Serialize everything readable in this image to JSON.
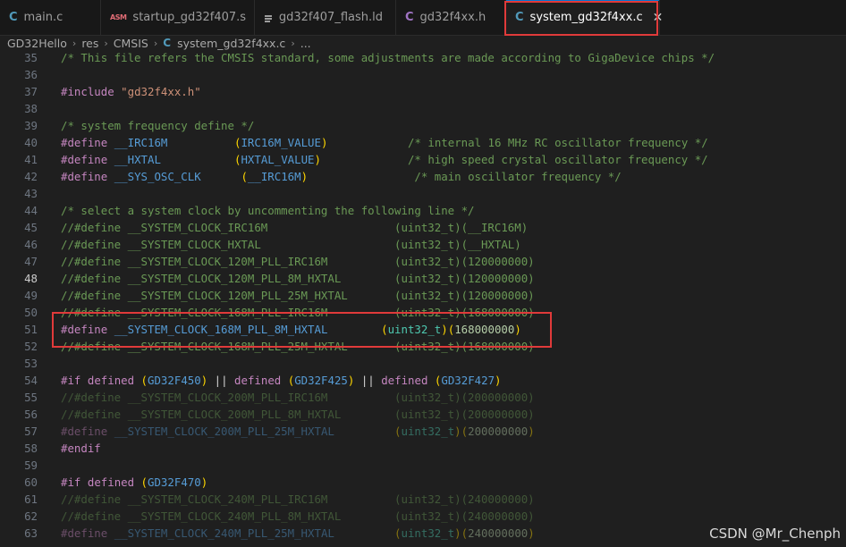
{
  "tabs": [
    {
      "icon": "c-file-icon",
      "label": "main.c"
    },
    {
      "icon": "asm-file-icon",
      "label": "startup_gd32f407.s"
    },
    {
      "icon": "linker-file-icon",
      "label": "gd32f407_flash.ld"
    },
    {
      "icon": "c-header-icon",
      "label": "gd32f4xx.h"
    },
    {
      "icon": "c-file-icon",
      "label": "system_gd32f4xx.c",
      "active": true
    }
  ],
  "tab_icons": {
    "c": "C",
    "asm": "ASM"
  },
  "close_glyph": "✕",
  "breadcrumb": [
    "GD32Hello",
    "res",
    "CMSIS",
    "system_gd32f4xx.c",
    "..."
  ],
  "breadcrumb_sep": "›",
  "current_line": 48,
  "lines": [
    {
      "n": "35",
      "code": "/* This file refers the CMSIS standard, some adjustments are made according to GigaDevice chips */"
    },
    {
      "n": "36",
      "code": ""
    },
    {
      "n": "37",
      "code": "#include \"gd32f4xx.h\""
    },
    {
      "n": "38",
      "code": ""
    },
    {
      "n": "39",
      "code": "/* system frequency define */"
    },
    {
      "n": "40",
      "code": "#define __IRC16M          (IRC16M_VALUE)            /* internal 16 MHz RC oscillator frequency */"
    },
    {
      "n": "41",
      "code": "#define __HXTAL           (HXTAL_VALUE)             /* high speed crystal oscillator frequency */"
    },
    {
      "n": "42",
      "code": "#define __SYS_OSC_CLK      (__IRC16M)                /* main oscillator frequency */"
    },
    {
      "n": "43",
      "code": ""
    },
    {
      "n": "44",
      "code": "/* select a system clock by uncommenting the following line */"
    },
    {
      "n": "45",
      "code": "//#define __SYSTEM_CLOCK_IRC16M                   (uint32_t)(__IRC16M)"
    },
    {
      "n": "46",
      "code": "//#define __SYSTEM_CLOCK_HXTAL                    (uint32_t)(__HXTAL)"
    },
    {
      "n": "47",
      "code": "//#define __SYSTEM_CLOCK_120M_PLL_IRC16M          (uint32_t)(120000000)"
    },
    {
      "n": "48",
      "code": "//#define __SYSTEM_CLOCK_120M_PLL_8M_HXTAL        (uint32_t)(120000000)"
    },
    {
      "n": "49",
      "code": "//#define __SYSTEM_CLOCK_120M_PLL_25M_HXTAL       (uint32_t)(120000000)"
    },
    {
      "n": "50",
      "code": "//#define __SYSTEM_CLOCK_168M_PLL_IRC16M          (uint32_t)(168000000)"
    },
    {
      "n": "51",
      "code": "#define __SYSTEM_CLOCK_168M_PLL_8M_HXTAL        (uint32_t)(168000000)"
    },
    {
      "n": "52",
      "code": "//#define __SYSTEM_CLOCK_168M_PLL_25M_HXTAL       (uint32_t)(168000000)"
    },
    {
      "n": "53",
      "code": ""
    },
    {
      "n": "54",
      "code": "#if defined (GD32F450) || defined (GD32F425) || defined (GD32F427)"
    },
    {
      "n": "55",
      "code": "//#define __SYSTEM_CLOCK_200M_PLL_IRC16M          (uint32_t)(200000000)",
      "dim": true
    },
    {
      "n": "56",
      "code": "//#define __SYSTEM_CLOCK_200M_PLL_8M_HXTAL        (uint32_t)(200000000)",
      "dim": true
    },
    {
      "n": "57",
      "code": "#define __SYSTEM_CLOCK_200M_PLL_25M_HXTAL         (uint32_t)(200000000)",
      "dim": true
    },
    {
      "n": "58",
      "code": "#endif"
    },
    {
      "n": "59",
      "code": ""
    },
    {
      "n": "60",
      "code": "#if defined (GD32F470)"
    },
    {
      "n": "61",
      "code": "//#define __SYSTEM_CLOCK_240M_PLL_IRC16M          (uint32_t)(240000000)",
      "dim": true
    },
    {
      "n": "62",
      "code": "//#define __SYSTEM_CLOCK_240M_PLL_8M_HXTAL        (uint32_t)(240000000)",
      "dim": true
    },
    {
      "n": "63",
      "code": "#define __SYSTEM_CLOCK_240M_PLL_25M_HXTAL         (uint32_t)(240000000)",
      "dim": true
    }
  ],
  "watermark": "CSDN @Mr_Chenph",
  "colors": {
    "highlight_box": "#e03a3a",
    "background": "#1f1f1f",
    "tab_bar": "#181818"
  }
}
